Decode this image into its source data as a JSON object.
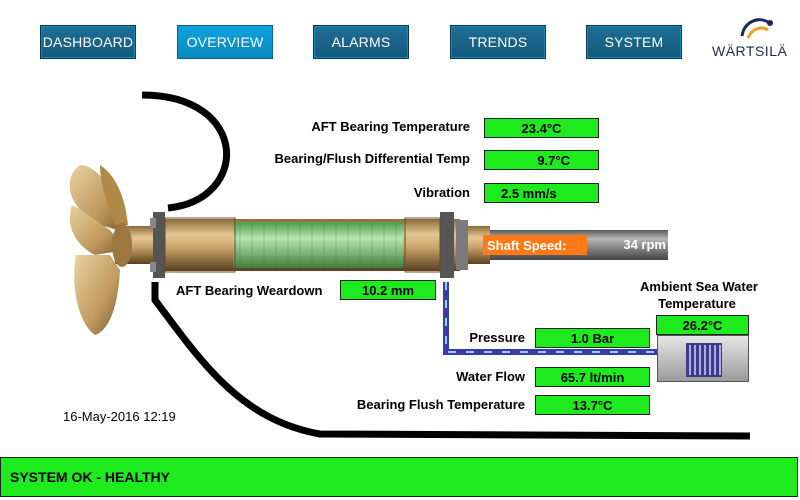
{
  "nav": {
    "items": [
      {
        "label": "DASHBOARD",
        "active": false
      },
      {
        "label": "OVERVIEW",
        "active": true
      },
      {
        "label": "ALARMS",
        "active": false
      },
      {
        "label": "TRENDS",
        "active": false
      },
      {
        "label": "SYSTEM",
        "active": false
      }
    ]
  },
  "brand": {
    "name": "WÄRTSILÄ"
  },
  "readings": {
    "aft_bearing_temperature": {
      "label": "AFT Bearing Temperature",
      "value": "23.4°C"
    },
    "differential_temp": {
      "label": "Bearing/Flush Differential Temp",
      "value": "9.7°C"
    },
    "vibration": {
      "label": "Vibration",
      "value": "2.5 mm/s"
    },
    "shaft_speed": {
      "label": "Shaft Speed:",
      "value": "34 rpm"
    },
    "weardown": {
      "label": "AFT Bearing Weardown",
      "value": "10.2 mm"
    },
    "sea_water_temp": {
      "label_line1": "Ambient Sea Water",
      "label_line2": "Temperature",
      "value": "26.2°C"
    },
    "pressure": {
      "label": "Pressure",
      "value": "1.0 Bar"
    },
    "water_flow": {
      "label": "Water Flow",
      "value": "65.7 lt/min"
    },
    "flush_temperature": {
      "label": "Bearing Flush Temperature",
      "value": "13.7°C"
    }
  },
  "timestamp": "16-May-2016 12:19",
  "status": {
    "text": "SYSTEM OK - HEALTHY"
  },
  "colors": {
    "ok_green": "#1eeb1e",
    "nav_blue": "#14597d",
    "nav_active": "#0ea3e0",
    "shaft_orange": "#ff7a16",
    "bronze": "#c9a36a",
    "bearing_green": "#7fc77a",
    "flush_line": "#6a78e0"
  },
  "icons": [
    "propeller-icon",
    "wartsila-logo-icon",
    "heat-exchanger-icon"
  ]
}
